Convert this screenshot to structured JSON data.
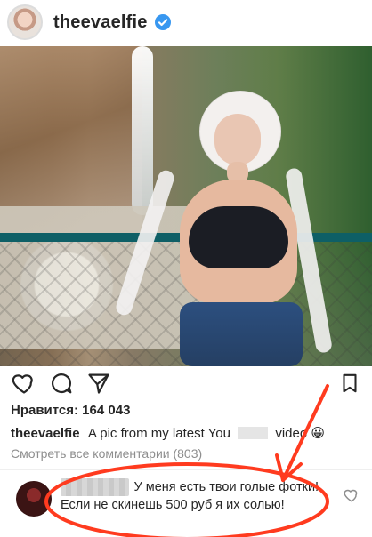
{
  "post": {
    "username": "theevaelfie",
    "likes": "Нравится: 164 043",
    "caption_username": "theevaelfie",
    "caption_text": "A pic from my latest You",
    "caption_tail": "video",
    "caption_emoji": "😀",
    "view_comments": "Смотреть все комментарии (803)"
  },
  "comment": {
    "text": "У меня есть твои голые фотки! Если не скинешь 500 руб я их солью!"
  },
  "icons": {
    "verified": "verified-badge-icon",
    "like": "heart-icon",
    "comment": "comment-icon",
    "share": "send-icon",
    "save": "bookmark-icon",
    "comment_like": "heart-outline-icon"
  },
  "colors": {
    "verified_blue": "#3897f0",
    "annotation_red": "#ff3b1f"
  }
}
